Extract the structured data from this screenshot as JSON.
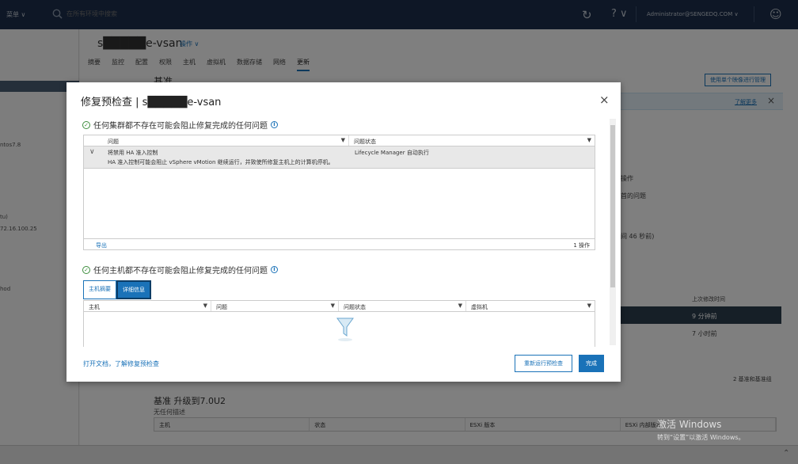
{
  "topbar": {
    "menu_label": "菜单 ∨",
    "search_placeholder": "在所有环境中搜索",
    "refresh_icon": "↻",
    "help_label": "? ∨",
    "user_label": "Administrator@SENGEDQ.COM ∨",
    "user_icon": "☺"
  },
  "left_tree": {
    "items": [
      "ntos7.8",
      "tu)",
      "72.16.100.25",
      "hod"
    ]
  },
  "object": {
    "title": "s█████e-vsan",
    "actions_label": "操作 ∨"
  },
  "tabs": [
    "摘要",
    "监控",
    "配置",
    "权限",
    "主机",
    "虚拟机",
    "数据存储",
    "网络",
    "更新"
  ],
  "background": {
    "baseline_header": "基准",
    "single_image_button": "使用单个映像进行管理",
    "learn_more": "了解更多",
    "misc": [
      "操作",
      "首的问题",
      "间 46 秒前)",
      "上次修改时间",
      "9 分钟前",
      "7 小时前",
      "2 基准和基准组"
    ],
    "baseline_upgrade_title": "基准 升级到7.0U2",
    "baseline_upgrade_desc": "无任何描述",
    "baseline_columns": [
      "主机",
      "状态",
      "ESXi 版本",
      "ESXi 内部版本"
    ]
  },
  "modal": {
    "title": "修复预检查 | s█████e-vsan",
    "close_icon": "×",
    "section1": {
      "heading": "任何集群都不存在可能会阻止修复完成的任何问题",
      "columns": [
        "问题",
        "问题状态"
      ],
      "rows": [
        {
          "issue": "将禁用 HA 准入控制",
          "detail": "HA 准入控制可能会阻止 vSphere vMotion 继续运行，并致使所修复主机上的计算机停机。",
          "status": "Lifecycle Manager 自动执行"
        }
      ],
      "export_label": "导出",
      "count_label": "1 操作"
    },
    "section2": {
      "heading": "任何主机都不存在可能会阻止修复完成的任何问题",
      "segments": [
        "主机摘要",
        "详细信息"
      ],
      "selected_segment": "详细信息",
      "columns": [
        "主机",
        "问题",
        "问题状态",
        "虚拟机"
      ]
    },
    "footer_link": "打开文档，了解修复预检查",
    "rerun_button": "重新运行预检查",
    "done_button": "完成"
  },
  "watermark": {
    "line1": "激活 Windows",
    "line2": "转到“设置”以激活 Windows。"
  }
}
